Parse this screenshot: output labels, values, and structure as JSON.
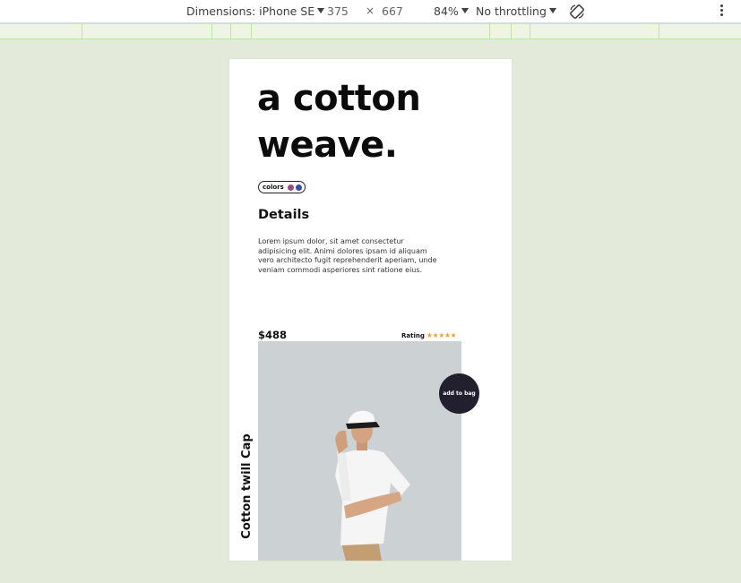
{
  "devtools": {
    "device_label": "Dimensions: iPhone SE",
    "width": "375",
    "times": "×",
    "height": "667",
    "zoom": "84%",
    "throttling": "No throttling",
    "rotate_icon": "rotate-icon",
    "more_icon": "more-vertical-icon"
  },
  "page": {
    "headline": "a cotton weave.",
    "colors_label": "colors",
    "color_swatches": [
      "#9a4a7c",
      "#3a4aa8"
    ],
    "details_title": "Details",
    "details_text": "Lorem ipsum dolor, sit amet consectetur adipisicing elit. Animi dolores ipsam id aliquam vero architecto fugit reprehenderit aperiam, unde veniam commodi asperiores sint ratione eius.",
    "price": "$488",
    "rating_label": "Rating",
    "rating_stars": "★★★★★",
    "add_to_bag": "add to bag",
    "product_name": "Cotton twill Cap"
  },
  "colors": {
    "background": "#e3ead9",
    "button": "#221f2e",
    "star": "#e0a63a"
  }
}
